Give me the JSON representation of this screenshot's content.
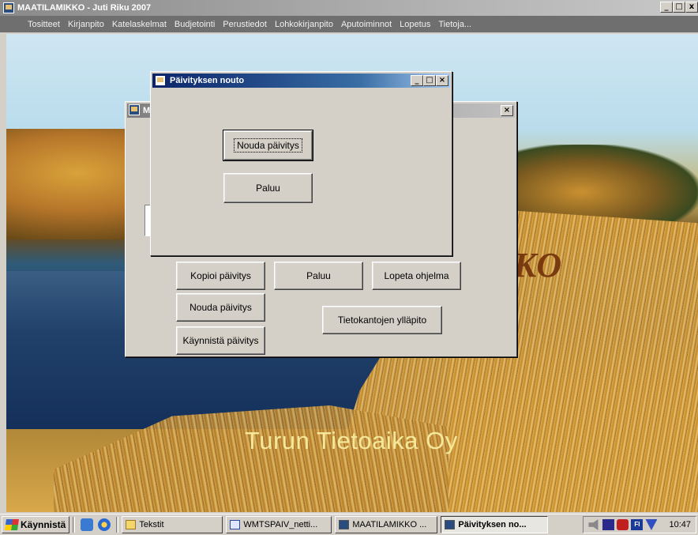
{
  "app": {
    "title": "MAATILAMIKKO - Juti Riku  2007",
    "controls": [
      "_",
      "□",
      "x"
    ]
  },
  "menubar": {
    "items": [
      "Tositteet",
      "Kirjanpito",
      "Katelaskelmat",
      "Budjetointi",
      "Perustiedot",
      "Lohkokirjanpito",
      "Aputoiminnot",
      "Lopetus",
      "Tietoja..."
    ]
  },
  "background": {
    "logo_text": "KO",
    "company_text": "Turun Tietoaika Oy"
  },
  "back_dialog": {
    "title": "M",
    "buttons": {
      "kopioi": "Kopioi päivitys",
      "paluu": "Paluu",
      "lopeta": "Lopeta ohjelma",
      "nouda": "Nouda päivitys",
      "tietokannat": "Tietokantojen ylläpito",
      "kaynnista": "Käynnistä päivitys"
    },
    "close_glyph": "×"
  },
  "front_dialog": {
    "title": "Päivityksen nouto",
    "buttons": {
      "nouda": "Nouda päivitys",
      "paluu": "Paluu"
    },
    "controls": [
      "_",
      "□",
      "×"
    ]
  },
  "taskbar": {
    "start_label": "Käynnistä",
    "tasks": [
      {
        "label": "Tekstit",
        "icon": "folder-icon"
      },
      {
        "label": "WMTSPAIV_netti...",
        "icon": "word-doc-icon"
      },
      {
        "label": "MAATILAMIKKO ...",
        "icon": "app-icon"
      },
      {
        "label": "Päivityksen no...",
        "icon": "app-icon",
        "active": true
      }
    ],
    "tray_lang": "FI",
    "clock": "10:47"
  }
}
